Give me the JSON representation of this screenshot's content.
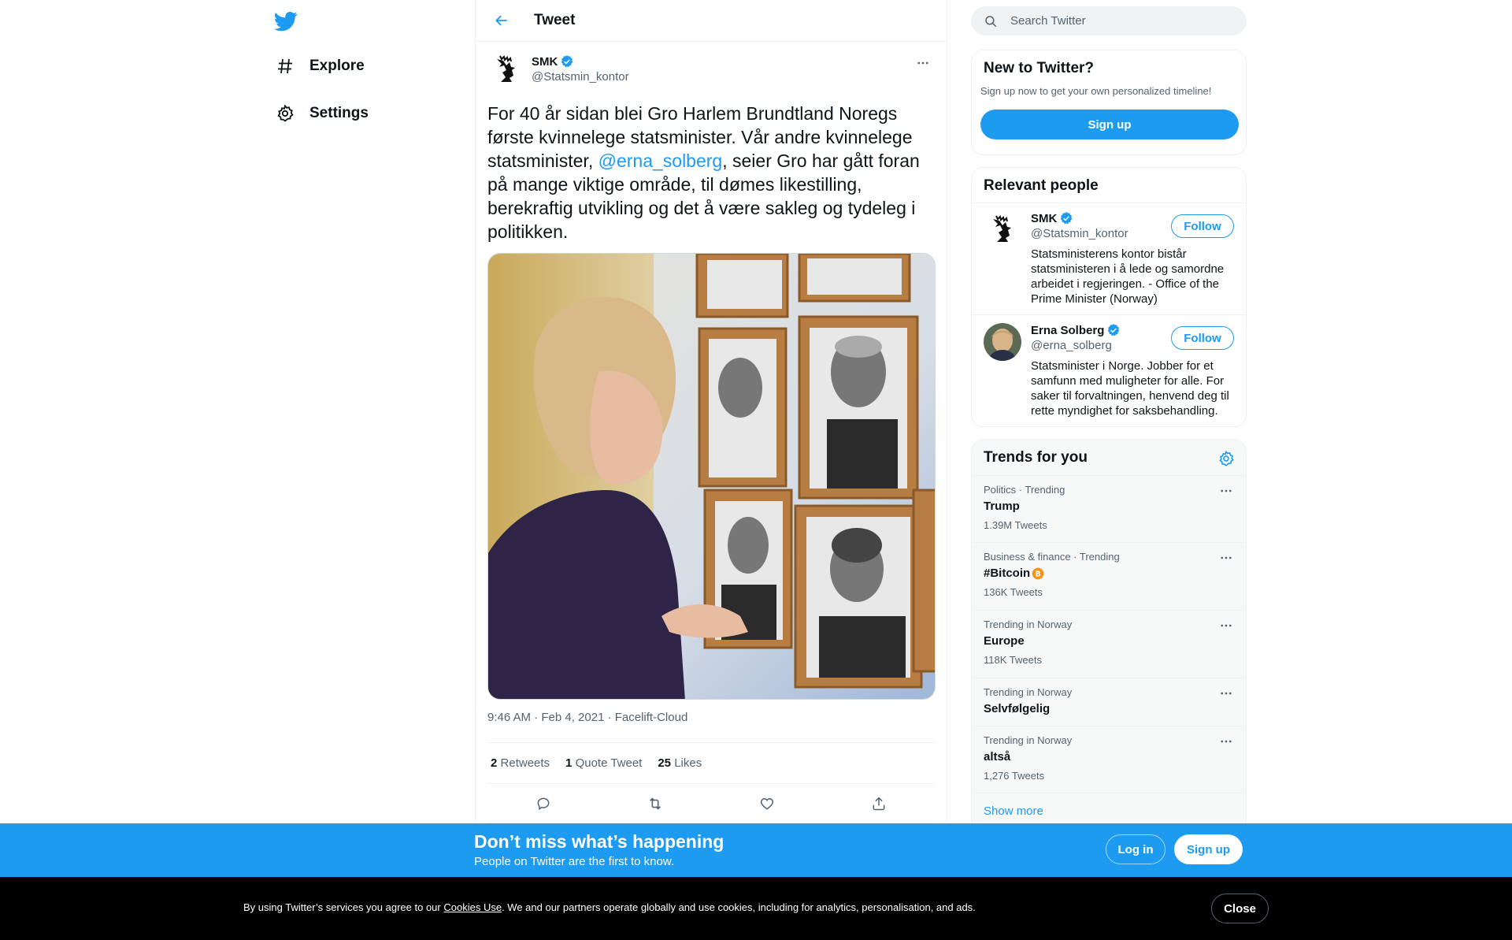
{
  "nav": {
    "logo": "twitter-bird-icon",
    "items": [
      {
        "label": "Explore",
        "icon": "hashtag-icon"
      },
      {
        "label": "Settings",
        "icon": "gear-icon"
      }
    ]
  },
  "header": {
    "title": "Tweet"
  },
  "tweet": {
    "author_name": "SMK",
    "author_handle": "@Statsmin_kontor",
    "text_before": "For 40 år sidan blei Gro Harlem Brundtland Noregs første kvinnelege statsminister. Vår andre kvinnelege statsminister, ",
    "mention": "@erna_solberg",
    "text_after": ", seier Gro har gått foran på mange viktige område, til dømes likestilling, berekraftig utvikling og det å være sakleg og tydeleg i politikken.",
    "timestamp": "9:46 AM · Feb 4, 2021 · Facelift-Cloud",
    "stats": {
      "retweets_count": "2",
      "retweets_label": "Retweets",
      "quotes_count": "1",
      "quotes_label": "Quote Tweet",
      "likes_count": "25",
      "likes_label": "Likes"
    }
  },
  "search": {
    "placeholder": "Search Twitter"
  },
  "new_to_twitter": {
    "title": "New to Twitter?",
    "subtitle": "Sign up now to get your own personalized timeline!",
    "button": "Sign up"
  },
  "relevant_people": {
    "title": "Relevant people",
    "people": [
      {
        "name": "SMK",
        "handle": "@Statsmin_kontor",
        "bio": "Statsministerens kontor bistår statsministeren i å lede og samordne arbeidet i regjeringen. - Office of the Prime Minister (Norway)",
        "follow": "Follow"
      },
      {
        "name": "Erna Solberg",
        "handle": "@erna_solberg",
        "bio": "Statsminister i Norge. Jobber for et samfunn med muligheter for alle. For saker til forvaltningen, henvend deg til rette myndighet for saksbehandling.",
        "follow": "Follow"
      }
    ]
  },
  "trends": {
    "title": "Trends for you",
    "items": [
      {
        "context": "Politics · Trending",
        "name": "Trump",
        "count": "1.39M Tweets"
      },
      {
        "context": "Business & finance · Trending",
        "name": "#Bitcoin",
        "count": "136K Tweets",
        "emoji": "bitcoin-icon"
      },
      {
        "context": "Trending in Norway",
        "name": "Europe",
        "count": "118K Tweets"
      },
      {
        "context": "Trending in Norway",
        "name": "Selvfølgelig",
        "count": ""
      },
      {
        "context": "Trending in Norway",
        "name": "altså",
        "count": "1,276 Tweets"
      }
    ],
    "show_more": "Show more"
  },
  "banner": {
    "title": "Don’t miss what’s happening",
    "subtitle": "People on Twitter are the first to know.",
    "login": "Log in",
    "signup": "Sign up"
  },
  "cookies": {
    "prefix": "By using Twitter’s services you agree to our ",
    "link": "Cookies Use",
    "suffix": ". We and our partners operate globally and use cookies, including for analytics, personalisation, and ads.",
    "close": "Close"
  },
  "colors": {
    "accent": "#1d9bf0",
    "text": "#0f1419",
    "secondary": "#536471"
  }
}
